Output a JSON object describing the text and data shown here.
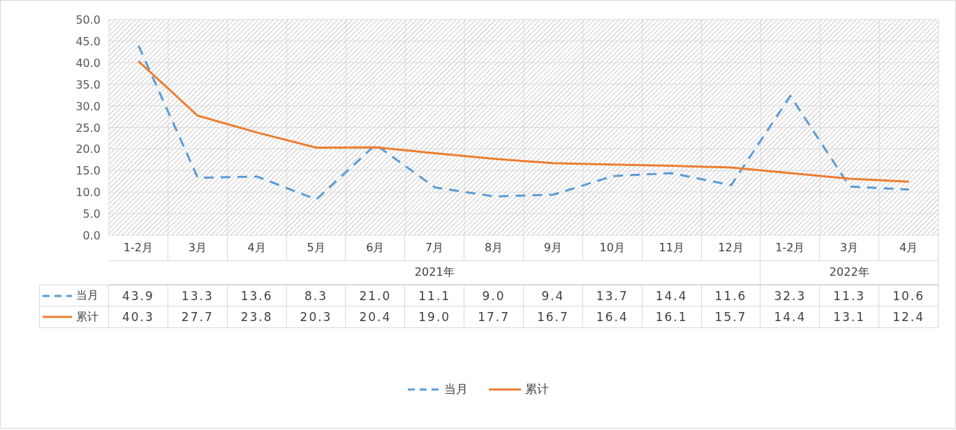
{
  "chart": {
    "chart_data": {
      "type": "line",
      "categories": [
        "1-2月",
        "3月",
        "4月",
        "5月",
        "6月",
        "7月",
        "8月",
        "9月",
        "10月",
        "11月",
        "12月",
        "1-2月",
        "3月",
        "4月"
      ],
      "series": [
        {
          "name": "当月",
          "color": "#5b9bd5",
          "line_style": "dashed",
          "values": [
            43.9,
            13.3,
            13.6,
            8.3,
            21.0,
            11.1,
            9.0,
            9.4,
            13.7,
            14.4,
            11.6,
            32.3,
            11.3,
            10.6
          ]
        },
        {
          "name": "累计",
          "color": "#ed7d31",
          "line_style": "solid",
          "values": [
            40.3,
            27.7,
            23.8,
            20.3,
            20.4,
            19.0,
            17.7,
            16.7,
            16.4,
            16.1,
            15.7,
            14.4,
            13.1,
            12.4
          ]
        }
      ],
      "ylim": [
        0,
        50
      ],
      "grid": true,
      "legend": "bottom",
      "yticks": [
        {
          "value": 0,
          "label": "0.0"
        },
        {
          "value": 5,
          "label": "5.0"
        },
        {
          "value": 10,
          "label": "10.0"
        },
        {
          "value": 15,
          "label": "15.0"
        },
        {
          "value": 20,
          "label": "20.0"
        },
        {
          "value": 25,
          "label": "25.0"
        },
        {
          "value": 30,
          "label": "30.0"
        },
        {
          "value": 35,
          "label": "35.0"
        },
        {
          "value": 40,
          "label": "40.0"
        },
        {
          "value": 45,
          "label": "45.0"
        },
        {
          "value": 50,
          "label": "50.0"
        }
      ]
    },
    "axis_groups": [
      {
        "label": "2021年"
      },
      {
        "label": "2022年"
      }
    ],
    "data_table": [
      {
        "name": "当月",
        "kind": "dashed",
        "color": "#5b9bd5",
        "cells": [
          [
            "43.9",
            "13.3",
            "13.6",
            "8.3",
            "21.0",
            "11.1",
            "9.0",
            "9.4",
            "13.7",
            "14.4",
            "11.6"
          ],
          [
            "32.3",
            "11.3",
            "10.6"
          ]
        ]
      },
      {
        "name": "累计",
        "kind": "solid",
        "color": "#ed7d31",
        "cells": [
          [
            "40.3",
            "27.7",
            "23.8",
            "20.3",
            "20.4",
            "19.0",
            "17.7",
            "16.7",
            "16.4",
            "16.1",
            "15.7"
          ],
          [
            "14.4",
            "13.1",
            "12.4"
          ]
        ]
      }
    ]
  }
}
